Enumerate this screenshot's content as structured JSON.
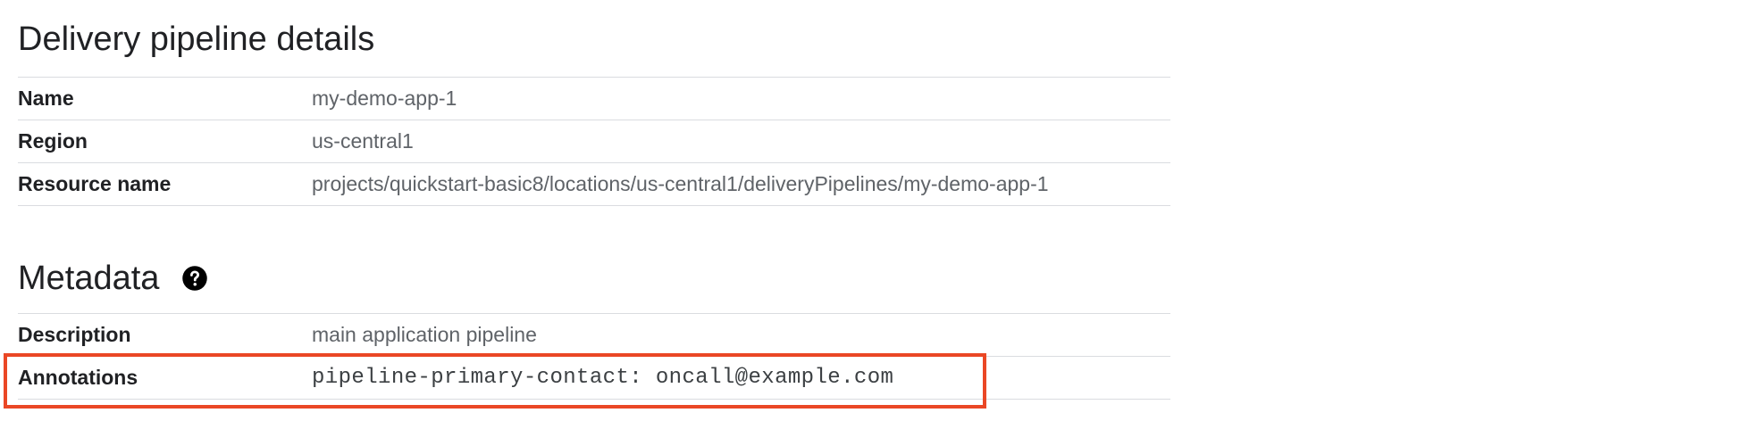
{
  "pipeline_details": {
    "title": "Delivery pipeline details",
    "rows": [
      {
        "label": "Name",
        "value": "my-demo-app-1"
      },
      {
        "label": "Region",
        "value": "us-central1"
      },
      {
        "label": "Resource name",
        "value": "projects/quickstart-basic8/locations/us-central1/deliveryPipelines/my-demo-app-1"
      }
    ]
  },
  "metadata": {
    "title": "Metadata",
    "help_icon": "help-circle-icon",
    "rows": [
      {
        "label": "Description",
        "value": "main application pipeline"
      },
      {
        "label": "Annotations",
        "value": "pipeline-primary-contact: oncall@example.com"
      }
    ]
  },
  "colors": {
    "highlight": "#ea4725",
    "divider": "#dadce0",
    "value_text": "#5f6368"
  }
}
